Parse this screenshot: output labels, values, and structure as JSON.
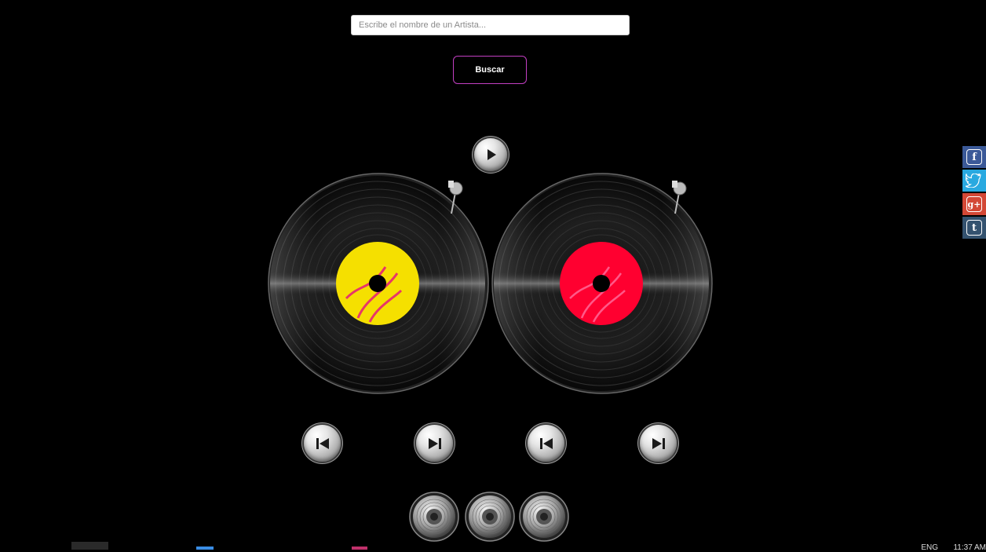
{
  "search": {
    "placeholder": "Escribe el nombre de un Artista..."
  },
  "buttons": {
    "search_label": "Buscar"
  },
  "player": {
    "controls": [
      "play-icon",
      "previous-track-icon",
      "next-track-icon",
      "previous-track-icon",
      "next-track-icon"
    ],
    "knobs": [
      "knob-icon",
      "knob-icon",
      "knob-icon"
    ]
  },
  "records": [
    {
      "label_color": "#f5e000"
    },
    {
      "label_color": "#ff0030"
    }
  ],
  "social": [
    {
      "name": "facebook",
      "glyph": "f",
      "color": "#3b5998"
    },
    {
      "name": "twitter",
      "glyph": "t",
      "color": "#29a9e0"
    },
    {
      "name": "google-plus",
      "glyph": "g+",
      "color": "#d34836"
    },
    {
      "name": "tumblr",
      "glyph": "t",
      "color": "#34526f"
    }
  ],
  "taskbar": {
    "language": "ENG",
    "time": "11:37 AM"
  }
}
